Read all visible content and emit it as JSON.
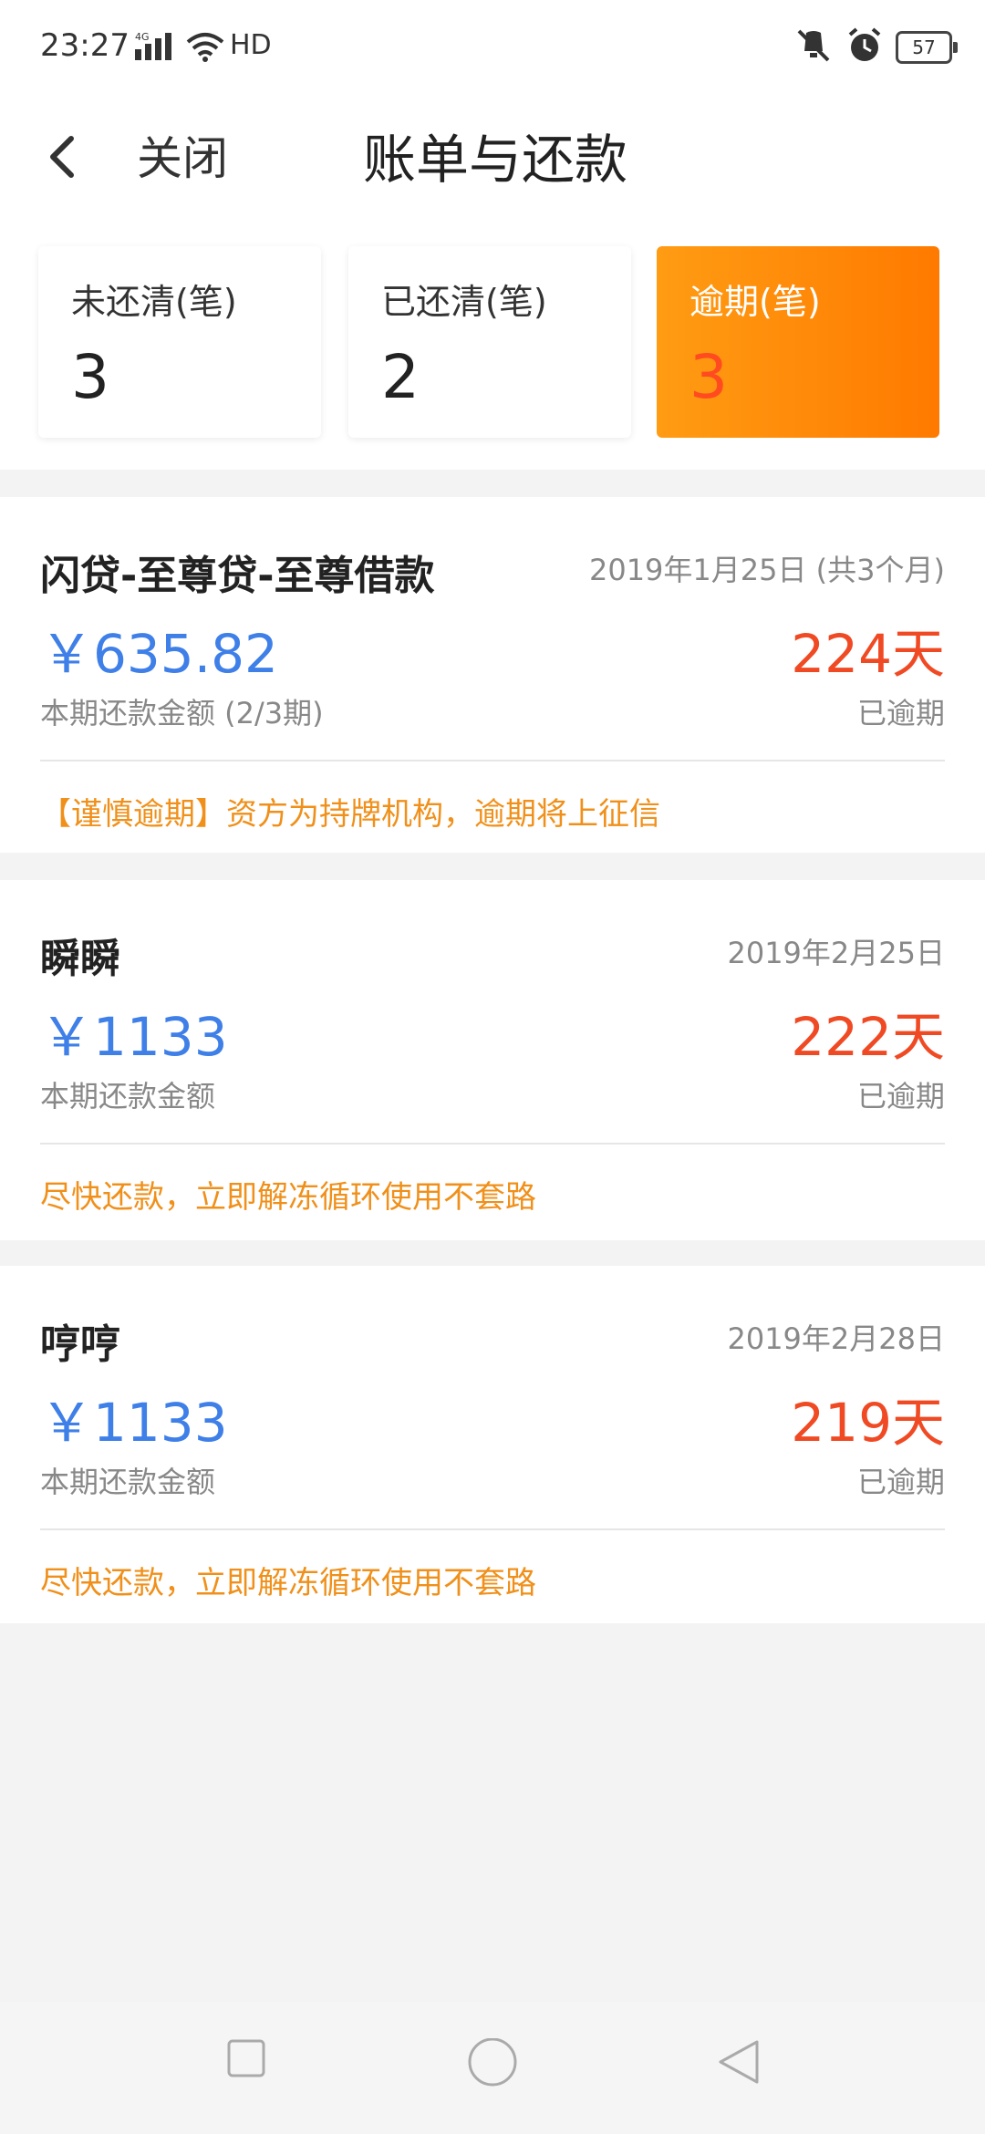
{
  "status": {
    "time": "23:27",
    "network": "4G",
    "hd": "HD",
    "battery": "57"
  },
  "header": {
    "close_label": "关闭",
    "title": "账单与还款"
  },
  "summary": [
    {
      "label": "未还清(笔)",
      "value": "3"
    },
    {
      "label": "已还清(笔)",
      "value": "2"
    },
    {
      "label": "逾期(笔)",
      "value": "3"
    }
  ],
  "loans": [
    {
      "name": "闪贷-至尊贷-至尊借款",
      "date": "2019年1月25日 (共3个月)",
      "amount": "￥635.82",
      "days": "224天",
      "sub_label": "本期还款金额 (2/3期)",
      "status": "已逾期",
      "note": "【谨慎逾期】资方为持牌机构，逾期将上征信"
    },
    {
      "name": "瞬瞬",
      "date": "2019年2月25日",
      "amount": "￥1133",
      "days": "222天",
      "sub_label": "本期还款金额",
      "status": "已逾期",
      "note": "尽快还款，立即解冻循环使用不套路"
    },
    {
      "name": "哼哼",
      "date": "2019年2月28日",
      "amount": "￥1133",
      "days": "219天",
      "sub_label": "本期还款金额",
      "status": "已逾期",
      "note": "尽快还款，立即解冻循环使用不套路"
    }
  ],
  "colors": {
    "accent_orange": "#ff8a00",
    "amount_blue": "#3f7fe8",
    "overdue_red": "#f04a24",
    "note_orange": "#f0901a"
  },
  "icons": {
    "back": "chevron-left-icon",
    "signal": "signal-icon",
    "wifi": "wifi-icon",
    "mute": "vibrate-mute-icon",
    "alarm": "alarm-icon",
    "nav_recent": "square-icon",
    "nav_home": "circle-icon",
    "nav_back": "triangle-back-icon"
  }
}
